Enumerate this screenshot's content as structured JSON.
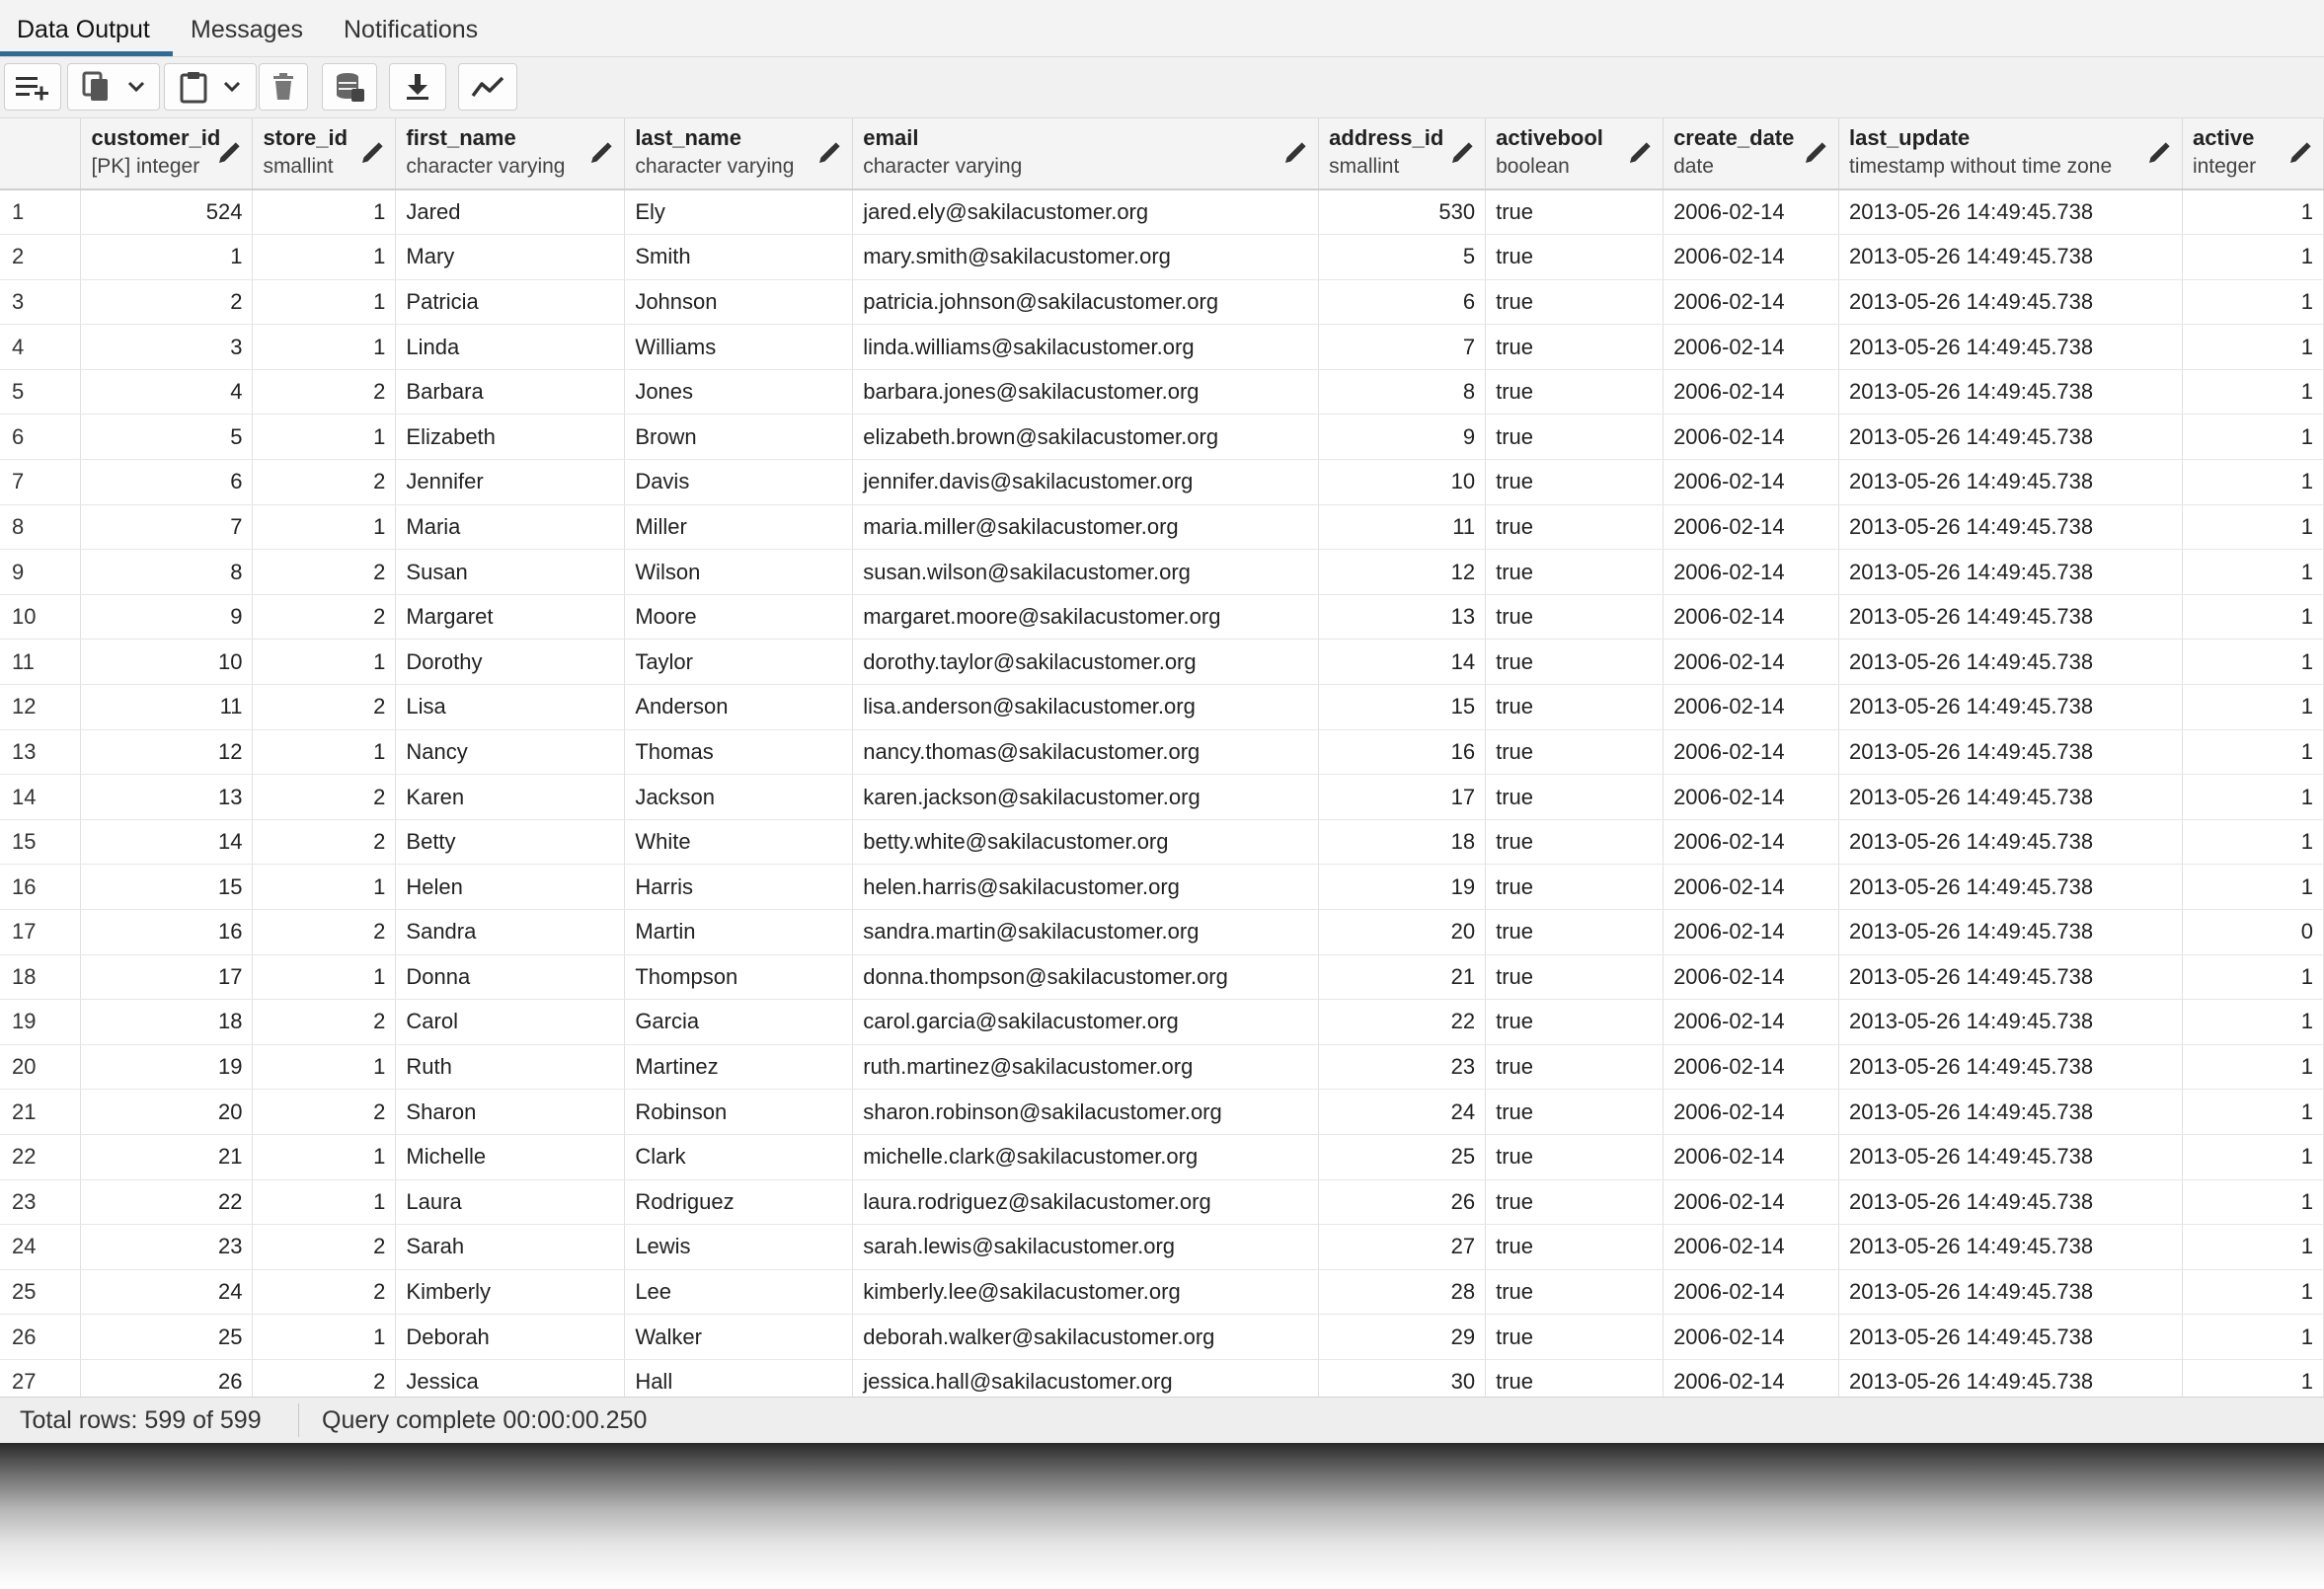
{
  "tabs": [
    {
      "label": "Data Output",
      "active": true
    },
    {
      "label": "Messages",
      "active": false
    },
    {
      "label": "Notifications",
      "active": false
    }
  ],
  "toolbar": {
    "icons": [
      "add-row-icon",
      "copy-icon",
      "chevron-down-icon",
      "paste-icon",
      "chevron-down-icon",
      "delete-icon",
      "save-data-icon",
      "download-icon",
      "graph-icon"
    ]
  },
  "columns": [
    {
      "name": "customer_id",
      "type": "[PK] integer"
    },
    {
      "name": "store_id",
      "type": "smallint"
    },
    {
      "name": "first_name",
      "type": "character varying"
    },
    {
      "name": "last_name",
      "type": "character varying"
    },
    {
      "name": "email",
      "type": "character varying"
    },
    {
      "name": "address_id",
      "type": "smallint"
    },
    {
      "name": "activebool",
      "type": "boolean"
    },
    {
      "name": "create_date",
      "type": "date"
    },
    {
      "name": "last_update",
      "type": "timestamp without time zone"
    },
    {
      "name": "active",
      "type": "integer"
    }
  ],
  "rows": [
    [
      "1",
      "524",
      "1",
      "Jared",
      "Ely",
      "jared.ely@sakilacustomer.org",
      "530",
      "true",
      "2006-02-14",
      "2013-05-26 14:49:45.738",
      "1"
    ],
    [
      "2",
      "1",
      "1",
      "Mary",
      "Smith",
      "mary.smith@sakilacustomer.org",
      "5",
      "true",
      "2006-02-14",
      "2013-05-26 14:49:45.738",
      "1"
    ],
    [
      "3",
      "2",
      "1",
      "Patricia",
      "Johnson",
      "patricia.johnson@sakilacustomer.org",
      "6",
      "true",
      "2006-02-14",
      "2013-05-26 14:49:45.738",
      "1"
    ],
    [
      "4",
      "3",
      "1",
      "Linda",
      "Williams",
      "linda.williams@sakilacustomer.org",
      "7",
      "true",
      "2006-02-14",
      "2013-05-26 14:49:45.738",
      "1"
    ],
    [
      "5",
      "4",
      "2",
      "Barbara",
      "Jones",
      "barbara.jones@sakilacustomer.org",
      "8",
      "true",
      "2006-02-14",
      "2013-05-26 14:49:45.738",
      "1"
    ],
    [
      "6",
      "5",
      "1",
      "Elizabeth",
      "Brown",
      "elizabeth.brown@sakilacustomer.org",
      "9",
      "true",
      "2006-02-14",
      "2013-05-26 14:49:45.738",
      "1"
    ],
    [
      "7",
      "6",
      "2",
      "Jennifer",
      "Davis",
      "jennifer.davis@sakilacustomer.org",
      "10",
      "true",
      "2006-02-14",
      "2013-05-26 14:49:45.738",
      "1"
    ],
    [
      "8",
      "7",
      "1",
      "Maria",
      "Miller",
      "maria.miller@sakilacustomer.org",
      "11",
      "true",
      "2006-02-14",
      "2013-05-26 14:49:45.738",
      "1"
    ],
    [
      "9",
      "8",
      "2",
      "Susan",
      "Wilson",
      "susan.wilson@sakilacustomer.org",
      "12",
      "true",
      "2006-02-14",
      "2013-05-26 14:49:45.738",
      "1"
    ],
    [
      "10",
      "9",
      "2",
      "Margaret",
      "Moore",
      "margaret.moore@sakilacustomer.org",
      "13",
      "true",
      "2006-02-14",
      "2013-05-26 14:49:45.738",
      "1"
    ],
    [
      "11",
      "10",
      "1",
      "Dorothy",
      "Taylor",
      "dorothy.taylor@sakilacustomer.org",
      "14",
      "true",
      "2006-02-14",
      "2013-05-26 14:49:45.738",
      "1"
    ],
    [
      "12",
      "11",
      "2",
      "Lisa",
      "Anderson",
      "lisa.anderson@sakilacustomer.org",
      "15",
      "true",
      "2006-02-14",
      "2013-05-26 14:49:45.738",
      "1"
    ],
    [
      "13",
      "12",
      "1",
      "Nancy",
      "Thomas",
      "nancy.thomas@sakilacustomer.org",
      "16",
      "true",
      "2006-02-14",
      "2013-05-26 14:49:45.738",
      "1"
    ],
    [
      "14",
      "13",
      "2",
      "Karen",
      "Jackson",
      "karen.jackson@sakilacustomer.org",
      "17",
      "true",
      "2006-02-14",
      "2013-05-26 14:49:45.738",
      "1"
    ],
    [
      "15",
      "14",
      "2",
      "Betty",
      "White",
      "betty.white@sakilacustomer.org",
      "18",
      "true",
      "2006-02-14",
      "2013-05-26 14:49:45.738",
      "1"
    ],
    [
      "16",
      "15",
      "1",
      "Helen",
      "Harris",
      "helen.harris@sakilacustomer.org",
      "19",
      "true",
      "2006-02-14",
      "2013-05-26 14:49:45.738",
      "1"
    ],
    [
      "17",
      "16",
      "2",
      "Sandra",
      "Martin",
      "sandra.martin@sakilacustomer.org",
      "20",
      "true",
      "2006-02-14",
      "2013-05-26 14:49:45.738",
      "0"
    ],
    [
      "18",
      "17",
      "1",
      "Donna",
      "Thompson",
      "donna.thompson@sakilacustomer.org",
      "21",
      "true",
      "2006-02-14",
      "2013-05-26 14:49:45.738",
      "1"
    ],
    [
      "19",
      "18",
      "2",
      "Carol",
      "Garcia",
      "carol.garcia@sakilacustomer.org",
      "22",
      "true",
      "2006-02-14",
      "2013-05-26 14:49:45.738",
      "1"
    ],
    [
      "20",
      "19",
      "1",
      "Ruth",
      "Martinez",
      "ruth.martinez@sakilacustomer.org",
      "23",
      "true",
      "2006-02-14",
      "2013-05-26 14:49:45.738",
      "1"
    ],
    [
      "21",
      "20",
      "2",
      "Sharon",
      "Robinson",
      "sharon.robinson@sakilacustomer.org",
      "24",
      "true",
      "2006-02-14",
      "2013-05-26 14:49:45.738",
      "1"
    ],
    [
      "22",
      "21",
      "1",
      "Michelle",
      "Clark",
      "michelle.clark@sakilacustomer.org",
      "25",
      "true",
      "2006-02-14",
      "2013-05-26 14:49:45.738",
      "1"
    ],
    [
      "23",
      "22",
      "1",
      "Laura",
      "Rodriguez",
      "laura.rodriguez@sakilacustomer.org",
      "26",
      "true",
      "2006-02-14",
      "2013-05-26 14:49:45.738",
      "1"
    ],
    [
      "24",
      "23",
      "2",
      "Sarah",
      "Lewis",
      "sarah.lewis@sakilacustomer.org",
      "27",
      "true",
      "2006-02-14",
      "2013-05-26 14:49:45.738",
      "1"
    ],
    [
      "25",
      "24",
      "2",
      "Kimberly",
      "Lee",
      "kimberly.lee@sakilacustomer.org",
      "28",
      "true",
      "2006-02-14",
      "2013-05-26 14:49:45.738",
      "1"
    ],
    [
      "26",
      "25",
      "1",
      "Deborah",
      "Walker",
      "deborah.walker@sakilacustomer.org",
      "29",
      "true",
      "2006-02-14",
      "2013-05-26 14:49:45.738",
      "1"
    ],
    [
      "27",
      "26",
      "2",
      "Jessica",
      "Hall",
      "jessica.hall@sakilacustomer.org",
      "30",
      "true",
      "2006-02-14",
      "2013-05-26 14:49:45.738",
      "1"
    ]
  ],
  "status": {
    "total_rows": "Total rows: 599 of 599",
    "query": "Query complete 00:00:00.250"
  }
}
